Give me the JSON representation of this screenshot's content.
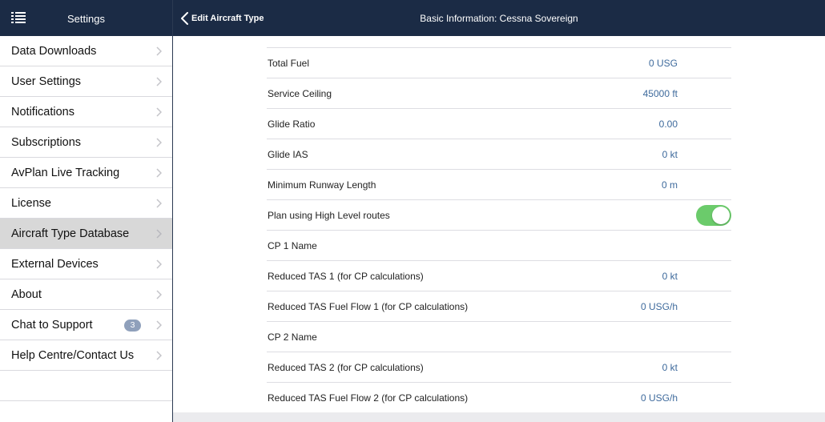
{
  "sidebar_header": {
    "title": "Settings",
    "menu_icon": "list-icon"
  },
  "detail_header": {
    "back_label": "Edit Aircraft Type",
    "title": "Basic Information: Cessna Sovereign"
  },
  "sidebar": {
    "items": [
      {
        "label": "Data Downloads"
      },
      {
        "label": "User Settings"
      },
      {
        "label": "Notifications"
      },
      {
        "label": "Subscriptions"
      },
      {
        "label": "AvPlan Live Tracking"
      },
      {
        "label": "License"
      },
      {
        "label": "Aircraft Type Database",
        "selected": true
      },
      {
        "label": "External Devices"
      },
      {
        "label": "About"
      },
      {
        "label": "Chat to Support",
        "badge": "3"
      },
      {
        "label": "Help Centre/Contact Us"
      }
    ]
  },
  "rows": [
    {
      "label": "Total Fuel",
      "value": "0 USG"
    },
    {
      "label": "Service Ceiling",
      "value": "45000 ft"
    },
    {
      "label": "Glide Ratio",
      "value": "0.00"
    },
    {
      "label": "Glide IAS",
      "value": "0 kt"
    },
    {
      "label": "Minimum Runway Length",
      "value": "0 m"
    },
    {
      "label": "Plan using High Level routes",
      "toggle": true
    },
    {
      "label": "CP 1 Name",
      "value": ""
    },
    {
      "label": "Reduced TAS 1 (for CP calculations)",
      "value": "0 kt"
    },
    {
      "label": "Reduced TAS Fuel Flow 1 (for CP calculations)",
      "value": "0 USG/h"
    },
    {
      "label": "CP 2 Name",
      "value": ""
    },
    {
      "label": "Reduced TAS 2 (for CP calculations)",
      "value": "0 kt"
    },
    {
      "label": "Reduced TAS Fuel Flow 2 (for CP calculations)",
      "value": "0 USG/h"
    }
  ],
  "colors": {
    "header_bg": "#1b2b45",
    "value_text": "#3e6a9c",
    "toggle_on": "#6bcb6b",
    "badge_bg": "#8fa0bb",
    "selected_bg": "#d8d8d8"
  }
}
